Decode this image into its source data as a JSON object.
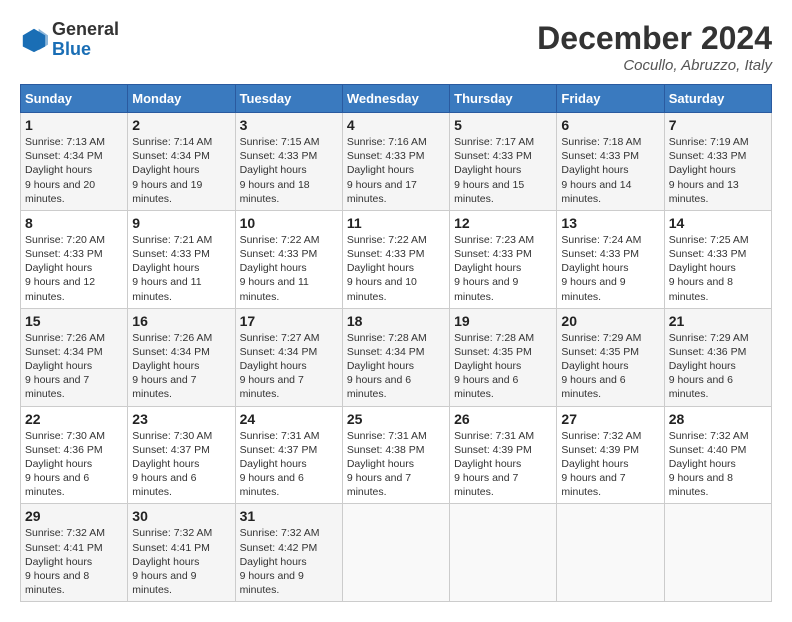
{
  "header": {
    "logo_general": "General",
    "logo_blue": "Blue",
    "month_title": "December 2024",
    "location": "Cocullo, Abruzzo, Italy"
  },
  "weekdays": [
    "Sunday",
    "Monday",
    "Tuesday",
    "Wednesday",
    "Thursday",
    "Friday",
    "Saturday"
  ],
  "weeks": [
    [
      {
        "day": "1",
        "sunrise": "7:13 AM",
        "sunset": "4:34 PM",
        "daylight": "9 hours and 20 minutes."
      },
      {
        "day": "2",
        "sunrise": "7:14 AM",
        "sunset": "4:34 PM",
        "daylight": "9 hours and 19 minutes."
      },
      {
        "day": "3",
        "sunrise": "7:15 AM",
        "sunset": "4:33 PM",
        "daylight": "9 hours and 18 minutes."
      },
      {
        "day": "4",
        "sunrise": "7:16 AM",
        "sunset": "4:33 PM",
        "daylight": "9 hours and 17 minutes."
      },
      {
        "day": "5",
        "sunrise": "7:17 AM",
        "sunset": "4:33 PM",
        "daylight": "9 hours and 15 minutes."
      },
      {
        "day": "6",
        "sunrise": "7:18 AM",
        "sunset": "4:33 PM",
        "daylight": "9 hours and 14 minutes."
      },
      {
        "day": "7",
        "sunrise": "7:19 AM",
        "sunset": "4:33 PM",
        "daylight": "9 hours and 13 minutes."
      }
    ],
    [
      {
        "day": "8",
        "sunrise": "7:20 AM",
        "sunset": "4:33 PM",
        "daylight": "9 hours and 12 minutes."
      },
      {
        "day": "9",
        "sunrise": "7:21 AM",
        "sunset": "4:33 PM",
        "daylight": "9 hours and 11 minutes."
      },
      {
        "day": "10",
        "sunrise": "7:22 AM",
        "sunset": "4:33 PM",
        "daylight": "9 hours and 11 minutes."
      },
      {
        "day": "11",
        "sunrise": "7:22 AM",
        "sunset": "4:33 PM",
        "daylight": "9 hours and 10 minutes."
      },
      {
        "day": "12",
        "sunrise": "7:23 AM",
        "sunset": "4:33 PM",
        "daylight": "9 hours and 9 minutes."
      },
      {
        "day": "13",
        "sunrise": "7:24 AM",
        "sunset": "4:33 PM",
        "daylight": "9 hours and 9 minutes."
      },
      {
        "day": "14",
        "sunrise": "7:25 AM",
        "sunset": "4:33 PM",
        "daylight": "9 hours and 8 minutes."
      }
    ],
    [
      {
        "day": "15",
        "sunrise": "7:26 AM",
        "sunset": "4:34 PM",
        "daylight": "9 hours and 7 minutes."
      },
      {
        "day": "16",
        "sunrise": "7:26 AM",
        "sunset": "4:34 PM",
        "daylight": "9 hours and 7 minutes."
      },
      {
        "day": "17",
        "sunrise": "7:27 AM",
        "sunset": "4:34 PM",
        "daylight": "9 hours and 7 minutes."
      },
      {
        "day": "18",
        "sunrise": "7:28 AM",
        "sunset": "4:34 PM",
        "daylight": "9 hours and 6 minutes."
      },
      {
        "day": "19",
        "sunrise": "7:28 AM",
        "sunset": "4:35 PM",
        "daylight": "9 hours and 6 minutes."
      },
      {
        "day": "20",
        "sunrise": "7:29 AM",
        "sunset": "4:35 PM",
        "daylight": "9 hours and 6 minutes."
      },
      {
        "day": "21",
        "sunrise": "7:29 AM",
        "sunset": "4:36 PM",
        "daylight": "9 hours and 6 minutes."
      }
    ],
    [
      {
        "day": "22",
        "sunrise": "7:30 AM",
        "sunset": "4:36 PM",
        "daylight": "9 hours and 6 minutes."
      },
      {
        "day": "23",
        "sunrise": "7:30 AM",
        "sunset": "4:37 PM",
        "daylight": "9 hours and 6 minutes."
      },
      {
        "day": "24",
        "sunrise": "7:31 AM",
        "sunset": "4:37 PM",
        "daylight": "9 hours and 6 minutes."
      },
      {
        "day": "25",
        "sunrise": "7:31 AM",
        "sunset": "4:38 PM",
        "daylight": "9 hours and 7 minutes."
      },
      {
        "day": "26",
        "sunrise": "7:31 AM",
        "sunset": "4:39 PM",
        "daylight": "9 hours and 7 minutes."
      },
      {
        "day": "27",
        "sunrise": "7:32 AM",
        "sunset": "4:39 PM",
        "daylight": "9 hours and 7 minutes."
      },
      {
        "day": "28",
        "sunrise": "7:32 AM",
        "sunset": "4:40 PM",
        "daylight": "9 hours and 8 minutes."
      }
    ],
    [
      {
        "day": "29",
        "sunrise": "7:32 AM",
        "sunset": "4:41 PM",
        "daylight": "9 hours and 8 minutes."
      },
      {
        "day": "30",
        "sunrise": "7:32 AM",
        "sunset": "4:41 PM",
        "daylight": "9 hours and 9 minutes."
      },
      {
        "day": "31",
        "sunrise": "7:32 AM",
        "sunset": "4:42 PM",
        "daylight": "9 hours and 9 minutes."
      },
      null,
      null,
      null,
      null
    ]
  ]
}
